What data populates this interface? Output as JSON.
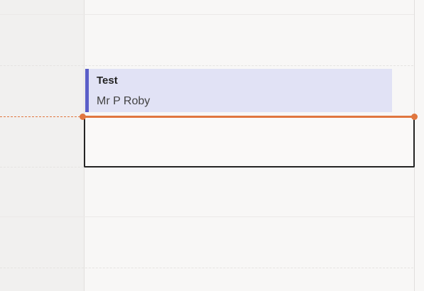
{
  "calendar": {
    "event": {
      "title": "Test",
      "organizer": "Mr P Roby",
      "accent_color": "#5b5fc7",
      "background_color": "#e1e2f5"
    },
    "current_time_indicator": {
      "color": "#e0763f"
    }
  }
}
